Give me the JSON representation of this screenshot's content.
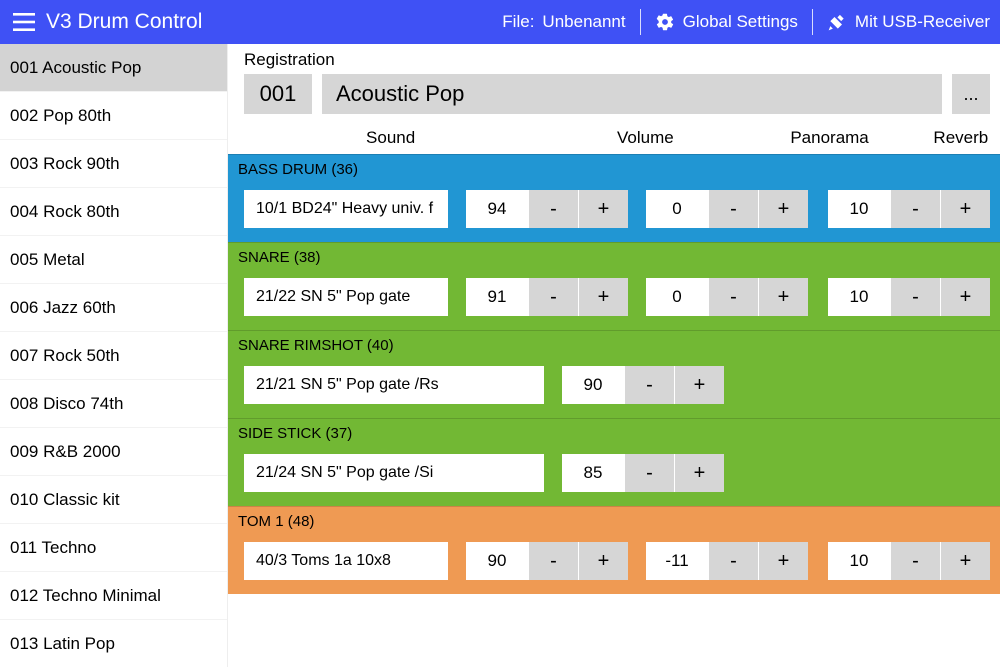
{
  "app_title": "V3 Drum Control",
  "header": {
    "file_label_prefix": "File: ",
    "file_name": "Unbenannt",
    "settings_label": "Global Settings",
    "usb_label": "Mit USB-Receiver"
  },
  "sidebar": {
    "selected_index": 0,
    "items": [
      {
        "label": "001 Acoustic Pop"
      },
      {
        "label": "002 Pop 80th"
      },
      {
        "label": "003 Rock 90th"
      },
      {
        "label": "004 Rock 80th"
      },
      {
        "label": "005 Metal"
      },
      {
        "label": "006 Jazz 60th"
      },
      {
        "label": "007 Rock 50th"
      },
      {
        "label": "008 Disco 74th"
      },
      {
        "label": "009 R&B 2000"
      },
      {
        "label": "010 Classic kit"
      },
      {
        "label": "011 Techno"
      },
      {
        "label": "012 Techno Minimal"
      },
      {
        "label": "013 Latin Pop"
      }
    ]
  },
  "registration": {
    "section_label": "Registration",
    "number": "001",
    "name": "Acoustic Pop",
    "more": "..."
  },
  "columns": {
    "sound": "Sound",
    "volume": "Volume",
    "panorama": "Panorama",
    "reverb": "Reverb"
  },
  "stepper_minus": "-",
  "stepper_plus": "+",
  "tracks": [
    {
      "color": "blue",
      "title": "BASS DRUM (36)",
      "sound": "10/1 BD24\"  Heavy  univ.  f",
      "volume": "94",
      "panorama": "0",
      "reverb": "10",
      "show_pan_reverb": true
    },
    {
      "color": "green",
      "title": "SNARE (38)",
      "sound": "21/22  SN 5\"  Pop  gate",
      "volume": "91",
      "panorama": "0",
      "reverb": "10",
      "show_pan_reverb": true
    },
    {
      "color": "green",
      "title": "SNARE RIMSHOT (40)",
      "sound": "21/21  SN 5\"  Pop  gate  /Rs",
      "volume": "90",
      "show_pan_reverb": false
    },
    {
      "color": "green",
      "title": "SIDE STICK (37)",
      "sound": "21/24  SN 5\"  Pop  gate  /Si",
      "volume": "85",
      "show_pan_reverb": false
    },
    {
      "color": "orange",
      "title": "TOM 1 (48)",
      "sound": "40/3  Toms 1a  10x8",
      "volume": "90",
      "panorama": "-11",
      "reverb": "10",
      "show_pan_reverb": true
    }
  ]
}
